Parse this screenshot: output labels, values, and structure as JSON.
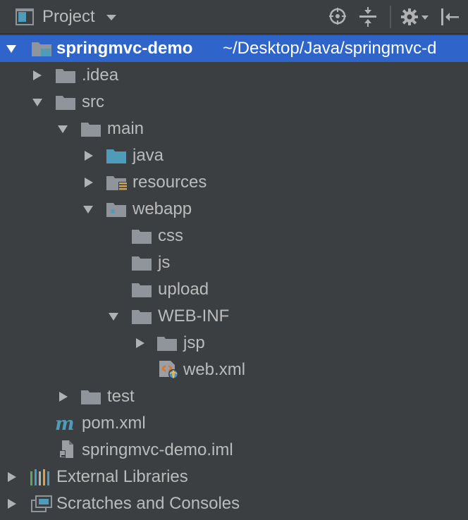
{
  "panel": {
    "title": "Project"
  },
  "toolbar_icons": [
    "locate-icon",
    "collapse-all-icon",
    "gear-icon",
    "hide-panel-icon"
  ],
  "colors": {
    "background": "#3c3f41",
    "selection": "#2f65ca",
    "text": "#bbbbbb",
    "folder": "#8f959b",
    "source_folder": "#4e9bba"
  },
  "tree": {
    "root": {
      "name": "springmvc-demo",
      "path": "~/Desktop/Java/springmvc-d"
    },
    "idea": ".idea",
    "src": "src",
    "main": "main",
    "java": "java",
    "resources": "resources",
    "webapp": "webapp",
    "css": "css",
    "js": "js",
    "upload": "upload",
    "webinf": "WEB-INF",
    "jsp": "jsp",
    "webxml": "web.xml",
    "test": "test",
    "pom": "pom.xml",
    "iml": "springmvc-demo.iml",
    "external": "External Libraries",
    "scratches": "Scratches and Consoles"
  }
}
